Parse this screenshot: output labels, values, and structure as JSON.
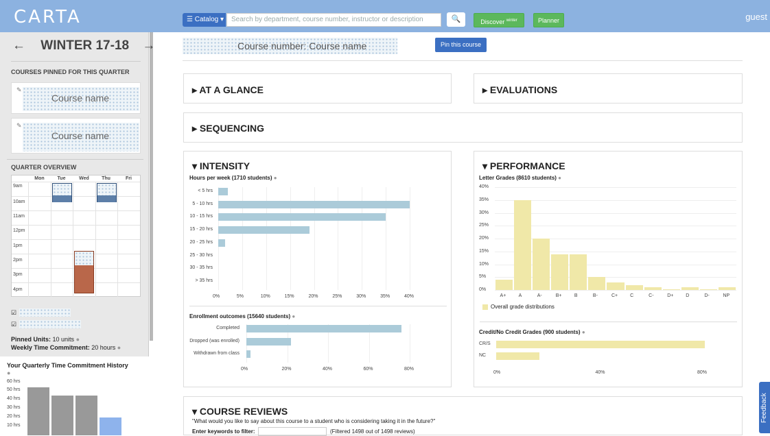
{
  "topbar": {
    "logo": "CARTA",
    "catalog_label": "☰ Catalog ▾",
    "search_placeholder": "Search by department, course number, instructor or description",
    "search_icon": "search-icon",
    "discover_label": "Discover",
    "discover_sup": "winter",
    "planner_label": "Planner",
    "user": "guest"
  },
  "sidebar": {
    "prev": "←",
    "quarter": "WINTER 17-18",
    "next": "→",
    "pinned_title": "COURSES PINNED FOR THIS QUARTER",
    "pinned": [
      "Course name",
      "Course name"
    ],
    "overview_title": "QUARTER OVERVIEW",
    "days": [
      "Mon",
      "Tue",
      "Wed",
      "Thu",
      "Fri"
    ],
    "hours": [
      "9am",
      "10am",
      "11am",
      "12pm",
      "1pm",
      "2pm",
      "3pm",
      "4pm"
    ],
    "pinned_units_label": "Pinned Units:",
    "pinned_units_value": "10 units",
    "weekly_label": "Weekly Time Commitment:",
    "weekly_value": "20 hours",
    "history_title": "Your Quarterly Time Commitment History",
    "history_ticks": [
      "60 hrs",
      "50 hrs",
      "40 hrs",
      "30 hrs",
      "20 hrs",
      "10 hrs"
    ],
    "history_values": [
      54,
      45,
      45,
      20
    ],
    "colors": {
      "event_blue": "#5d7fa8",
      "event_red": "#b9674a",
      "bar_gray": "#999999",
      "bar_blue": "#8eb3ec"
    }
  },
  "course": {
    "header": "Course number: Course name",
    "pin_label": "Pin this course",
    "sections": {
      "glance": "▸ AT A GLANCE",
      "evaluations": "▸ EVALUATIONS",
      "sequencing": "▸ SEQUENCING"
    }
  },
  "intensity": {
    "title": "▾ INTENSITY",
    "hours_title": "Hours per week (1710 students)",
    "enroll_title": "Enrollment outcomes (15640 students)"
  },
  "performance": {
    "title": "▾ PERFORMANCE",
    "letter_title": "Letter Grades (8610 students)",
    "legend": "Overall grade distributions",
    "credit_title": "Credit/No Credit Grades (900 students)"
  },
  "reviews": {
    "title": "▾ COURSE REVIEWS",
    "question": "\"What would you like to say about this course to a student who is considering taking it in the future?\"",
    "filter_label": "Enter keywords to filter:",
    "filter_value": "",
    "filter_count": "(Filtered 1498 out of 1498 reviews)"
  },
  "feedback": "Feedback",
  "chart_data": [
    {
      "type": "bar",
      "orientation": "horizontal",
      "title": "Hours per week (1710 students)",
      "categories": [
        "< 5 hrs",
        "5 - 10 hrs",
        "10 - 15 hrs",
        "15 - 20 hrs",
        "20 - 25 hrs",
        "25 - 30 hrs",
        "30 - 35 hrs",
        "> 35 hrs"
      ],
      "values": [
        2,
        40,
        35,
        19,
        1.5,
        0,
        0,
        0
      ],
      "ticks": [
        "0%",
        "5%",
        "10%",
        "15%",
        "20%",
        "25%",
        "30%",
        "35%",
        "40%"
      ],
      "xlim": [
        0,
        40
      ]
    },
    {
      "type": "bar",
      "orientation": "horizontal",
      "title": "Enrollment outcomes (15640 students)",
      "categories": [
        "Completed",
        "Dropped (was enrolled)",
        "Withdrawn from class"
      ],
      "values": [
        76,
        22,
        2
      ],
      "ticks": [
        "0%",
        "20%",
        "40%",
        "60%",
        "80%"
      ],
      "xlim": [
        0,
        80
      ]
    },
    {
      "type": "bar",
      "title": "Letter Grades (8610 students)",
      "categories": [
        "A+",
        "A",
        "A-",
        "B+",
        "B",
        "B-",
        "C+",
        "C",
        "C-",
        "D+",
        "D",
        "D-",
        "NP"
      ],
      "values": [
        4,
        35,
        20,
        14,
        14,
        5,
        3,
        2,
        1,
        0.3,
        1,
        0.3,
        1
      ],
      "ticks": [
        "40%",
        "35%",
        "30%",
        "25%",
        "20%",
        "15%",
        "10%",
        "5%",
        "0%"
      ],
      "ylim": [
        0,
        40
      ],
      "legend": "Overall grade distributions"
    },
    {
      "type": "bar",
      "orientation": "horizontal",
      "title": "Credit/No Credit Grades (900 students)",
      "categories": [
        "CR/S",
        "NC"
      ],
      "values": [
        82,
        17
      ],
      "ticks": [
        "0%",
        "40%",
        "80%"
      ],
      "xlim": [
        0,
        80
      ]
    }
  ]
}
